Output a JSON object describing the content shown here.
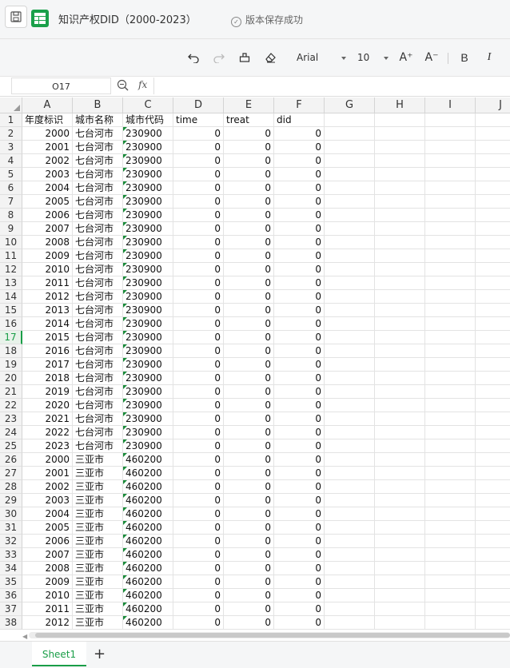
{
  "header": {
    "title": "知识产权DID（2000-2023）",
    "save_status": "版本保存成功"
  },
  "toolbar": {
    "font_name": "Arial",
    "font_size": "10",
    "undo_icon": "undo-icon",
    "redo_icon": "redo-icon",
    "format_painter_icon": "format-painter-icon",
    "clear_icon": "eraser-icon",
    "increase_font_label": "A⁺",
    "decrease_font_label": "A⁻",
    "bold_label": "B",
    "italic_label": "I"
  },
  "formula_bar": {
    "cell_ref": "O17",
    "fx_label": "fx",
    "value": ""
  },
  "active_row": 17,
  "columns": [
    "A",
    "B",
    "C",
    "D",
    "E",
    "F",
    "G",
    "H",
    "I",
    "J"
  ],
  "row_numbers": [
    1,
    2,
    3,
    4,
    5,
    6,
    7,
    8,
    9,
    10,
    11,
    12,
    13,
    14,
    15,
    16,
    17,
    18,
    19,
    20,
    21,
    22,
    23,
    24,
    25,
    26,
    27,
    28,
    29,
    30,
    31,
    32,
    33,
    34,
    35,
    36,
    37,
    38
  ],
  "rows": [
    [
      "年度标识",
      "城市名称",
      "城市代码",
      "time",
      "treat",
      "did"
    ],
    [
      "2000",
      "七台河市",
      "230900",
      "0",
      "0",
      "0"
    ],
    [
      "2001",
      "七台河市",
      "230900",
      "0",
      "0",
      "0"
    ],
    [
      "2002",
      "七台河市",
      "230900",
      "0",
      "0",
      "0"
    ],
    [
      "2003",
      "七台河市",
      "230900",
      "0",
      "0",
      "0"
    ],
    [
      "2004",
      "七台河市",
      "230900",
      "0",
      "0",
      "0"
    ],
    [
      "2005",
      "七台河市",
      "230900",
      "0",
      "0",
      "0"
    ],
    [
      "2006",
      "七台河市",
      "230900",
      "0",
      "0",
      "0"
    ],
    [
      "2007",
      "七台河市",
      "230900",
      "0",
      "0",
      "0"
    ],
    [
      "2008",
      "七台河市",
      "230900",
      "0",
      "0",
      "0"
    ],
    [
      "2009",
      "七台河市",
      "230900",
      "0",
      "0",
      "0"
    ],
    [
      "2010",
      "七台河市",
      "230900",
      "0",
      "0",
      "0"
    ],
    [
      "2011",
      "七台河市",
      "230900",
      "0",
      "0",
      "0"
    ],
    [
      "2012",
      "七台河市",
      "230900",
      "0",
      "0",
      "0"
    ],
    [
      "2013",
      "七台河市",
      "230900",
      "0",
      "0",
      "0"
    ],
    [
      "2014",
      "七台河市",
      "230900",
      "0",
      "0",
      "0"
    ],
    [
      "2015",
      "七台河市",
      "230900",
      "0",
      "0",
      "0"
    ],
    [
      "2016",
      "七台河市",
      "230900",
      "0",
      "0",
      "0"
    ],
    [
      "2017",
      "七台河市",
      "230900",
      "0",
      "0",
      "0"
    ],
    [
      "2018",
      "七台河市",
      "230900",
      "0",
      "0",
      "0"
    ],
    [
      "2019",
      "七台河市",
      "230900",
      "0",
      "0",
      "0"
    ],
    [
      "2020",
      "七台河市",
      "230900",
      "0",
      "0",
      "0"
    ],
    [
      "2021",
      "七台河市",
      "230900",
      "0",
      "0",
      "0"
    ],
    [
      "2022",
      "七台河市",
      "230900",
      "0",
      "0",
      "0"
    ],
    [
      "2023",
      "七台河市",
      "230900",
      "0",
      "0",
      "0"
    ],
    [
      "2000",
      "三亚市",
      "460200",
      "0",
      "0",
      "0"
    ],
    [
      "2001",
      "三亚市",
      "460200",
      "0",
      "0",
      "0"
    ],
    [
      "2002",
      "三亚市",
      "460200",
      "0",
      "0",
      "0"
    ],
    [
      "2003",
      "三亚市",
      "460200",
      "0",
      "0",
      "0"
    ],
    [
      "2004",
      "三亚市",
      "460200",
      "0",
      "0",
      "0"
    ],
    [
      "2005",
      "三亚市",
      "460200",
      "0",
      "0",
      "0"
    ],
    [
      "2006",
      "三亚市",
      "460200",
      "0",
      "0",
      "0"
    ],
    [
      "2007",
      "三亚市",
      "460200",
      "0",
      "0",
      "0"
    ],
    [
      "2008",
      "三亚市",
      "460200",
      "0",
      "0",
      "0"
    ],
    [
      "2009",
      "三亚市",
      "460200",
      "0",
      "0",
      "0"
    ],
    [
      "2010",
      "三亚市",
      "460200",
      "0",
      "0",
      "0"
    ],
    [
      "2011",
      "三亚市",
      "460200",
      "0",
      "0",
      "0"
    ],
    [
      "2012",
      "三亚市",
      "460200",
      "0",
      "0",
      "0"
    ]
  ],
  "sheet_tabs": [
    "Sheet1"
  ],
  "add_sheet_label": "+",
  "colors": {
    "accent": "#1a9e48",
    "number_text_tag": "#1a8b3a"
  }
}
